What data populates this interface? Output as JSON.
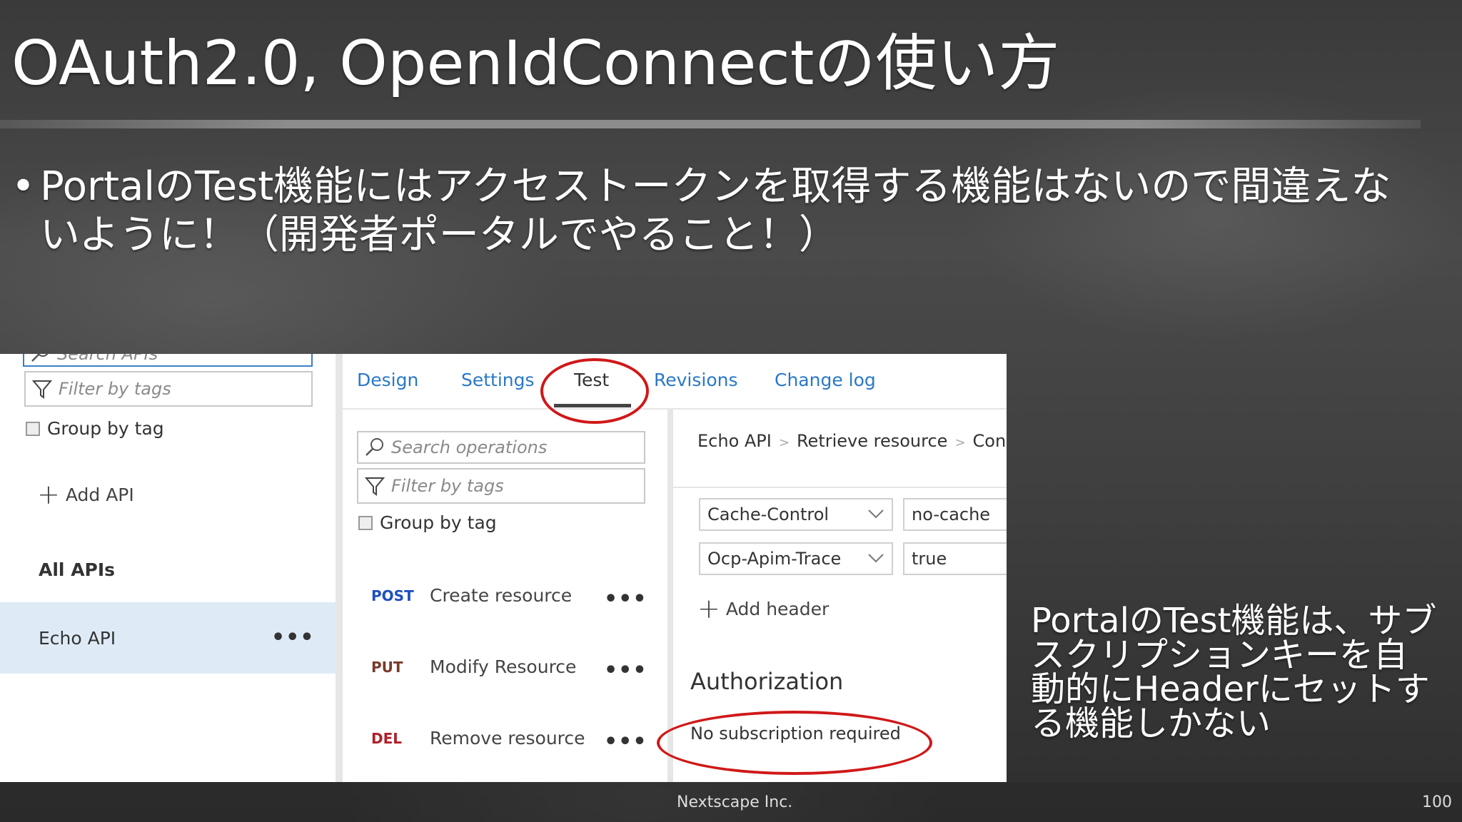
{
  "slide": {
    "title": "OAuth2.0, OpenIdConnectの使い方",
    "bullet_dot": "•",
    "bullet_line1": "PortalのTest機能にはアクセストークンを取得する機能はないので間違えな",
    "bullet_line2": "いように！（開発者ポータルでやること！）",
    "callout_line1": "PortalのTest機能は、サブ",
    "callout_line2": "スクリプションキーを自",
    "callout_line3": "動的にHeaderにセットす",
    "callout_line4": "る機能しかない",
    "footer_company": "Nextscape Inc.",
    "page_number": "100"
  },
  "left_panel": {
    "search_placeholder": "Search APIs",
    "filter_placeholder": "Filter by tags",
    "group_by_tag": "Group by tag",
    "add_api": "Add API",
    "all_apis": "All APIs",
    "api_item": "Echo API",
    "more": "•••"
  },
  "tabs": [
    "Design",
    "Settings",
    "Test",
    "Revisions",
    "Change log"
  ],
  "middle_panel": {
    "search_placeholder": "Search operations",
    "filter_placeholder": "Filter by tags",
    "group_by_tag": "Group by tag",
    "operations": [
      {
        "verb": "POST",
        "name": "Create resource"
      },
      {
        "verb": "PUT",
        "name": "Modify Resource"
      },
      {
        "verb": "DEL",
        "name": "Remove resource"
      }
    ],
    "more": "•••"
  },
  "right_panel": {
    "breadcrumb": [
      "Echo API",
      "Retrieve resource",
      "Cons"
    ],
    "breadcrumb_sep": ">",
    "headers": [
      {
        "name": "Cache-Control",
        "value": "no-cache"
      },
      {
        "name": "Ocp-Apim-Trace",
        "value": "true"
      }
    ],
    "add_header": "Add header",
    "authorization_title": "Authorization",
    "authorization_value": "No subscription required"
  },
  "colors": {
    "highlight": "#d01818",
    "tab_link": "#2a78c6",
    "selected_row": "#deebf7"
  }
}
